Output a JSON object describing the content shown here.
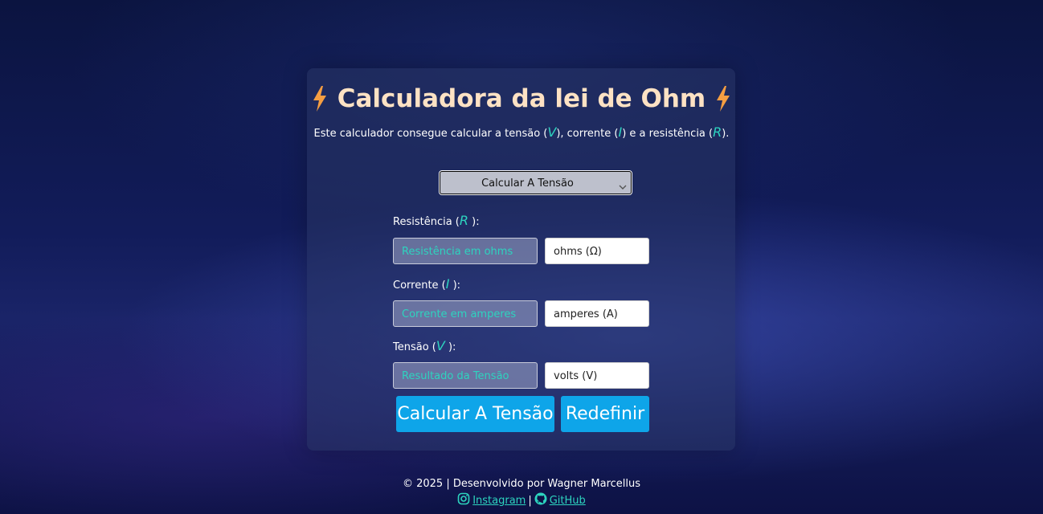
{
  "header": {
    "title": "Calculadora da lei de Ohm",
    "subtitle_parts": [
      "Este calculador consegue calcular a tensão (",
      "V",
      "), corrente (",
      "I",
      ") e a resistência (",
      "R",
      ")."
    ]
  },
  "mode_select": {
    "selected": "Calcular A Tensão"
  },
  "fields": {
    "resistance": {
      "label_prefix": "Resistência (",
      "symbol": "R",
      "label_suffix": "):",
      "placeholder": "Resistência em ohms",
      "unit": "ohms (Ω)"
    },
    "current": {
      "label_prefix": "Corrente (",
      "symbol": "I",
      "label_suffix": "):",
      "placeholder": "Corrente em amperes",
      "unit": "amperes (A)"
    },
    "voltage": {
      "label_prefix": "Tensão (",
      "symbol": "V",
      "label_suffix": "):",
      "placeholder": "Resultado da Tensão",
      "unit": "volts (V)"
    }
  },
  "buttons": {
    "calculate": "Calcular A Tensão",
    "reset": "Redefinir"
  },
  "footer": {
    "credit": "© 2025 | Desenvolvido por Wagner Marcellus",
    "instagram": "Instagram",
    "separator": "|",
    "github": "GitHub"
  },
  "colors": {
    "accent": "#2dd4bf",
    "button": "#0ea5e9",
    "title": "#fde2c4",
    "bolt": "#f59e42"
  }
}
